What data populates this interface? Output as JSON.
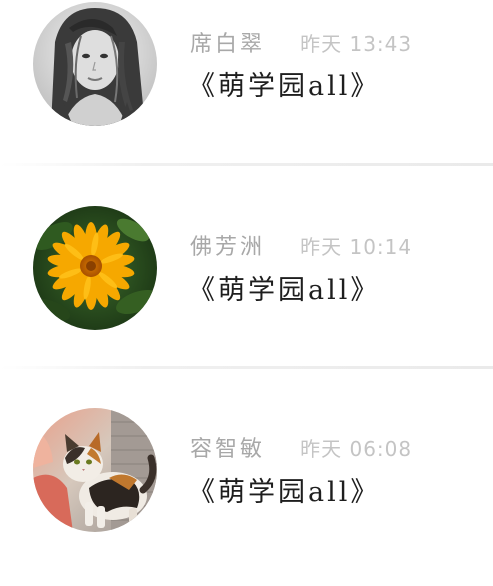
{
  "messages": [
    {
      "sender": "席白翠",
      "time": "昨天 13:43",
      "subject": "《萌学园all》",
      "avatar_icon": "portrait-photo-icon"
    },
    {
      "sender": "佛芳洲",
      "time": "昨天 10:14",
      "subject": "《萌学园all》",
      "avatar_icon": "flower-photo-icon"
    },
    {
      "sender": "容智敏",
      "time": "昨天 06:08",
      "subject": "《萌学园all》",
      "avatar_icon": "cat-photo-icon"
    }
  ],
  "colors": {
    "sender_text": "#a8a8a8",
    "time_text": "#c4c4c4",
    "subject_text": "#1e1e1e",
    "divider": "#eeeeee",
    "background": "#ffffff"
  }
}
